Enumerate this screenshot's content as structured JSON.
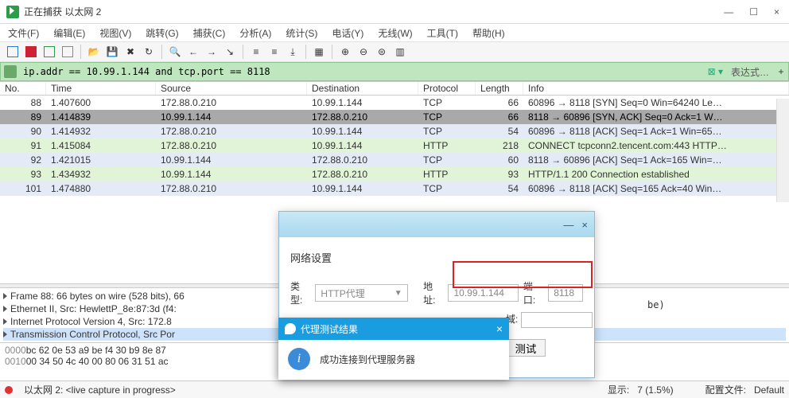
{
  "window": {
    "title": "正在捕获 以太网 2",
    "min": "—",
    "max": "☐",
    "close": "×"
  },
  "menu": [
    "文件(F)",
    "编辑(E)",
    "视图(V)",
    "跳转(G)",
    "捕获(C)",
    "分析(A)",
    "统计(S)",
    "电话(Y)",
    "无线(W)",
    "工具(T)",
    "帮助(H)"
  ],
  "filter": {
    "value": "ip.addr == 10.99.1.144 and tcp.port == 8118",
    "expr_label": "表达式…",
    "plus": "+"
  },
  "columns": {
    "no": "No.",
    "time": "Time",
    "src": "Source",
    "dst": "Destination",
    "proto": "Protocol",
    "len": "Length",
    "info": "Info"
  },
  "packets": [
    {
      "no": "88",
      "time": "1.407600",
      "src": "172.88.0.210",
      "dst": "10.99.1.144",
      "proto": "TCP",
      "len": "66",
      "info": "60896 → 8118 [SYN] Seq=0 Win=64240 Le…",
      "cls": "bg-white"
    },
    {
      "no": "89",
      "time": "1.414839",
      "src": "10.99.1.144",
      "dst": "172.88.0.210",
      "proto": "TCP",
      "len": "66",
      "info": "8118 → 60896 [SYN, ACK] Seq=0 Ack=1 W…",
      "cls": "bg-sel"
    },
    {
      "no": "90",
      "time": "1.414932",
      "src": "172.88.0.210",
      "dst": "10.99.1.144",
      "proto": "TCP",
      "len": "54",
      "info": "60896 → 8118 [ACK] Seq=1 Ack=1 Win=65…",
      "cls": "bg-blue"
    },
    {
      "no": "91",
      "time": "1.415084",
      "src": "172.88.0.210",
      "dst": "10.99.1.144",
      "proto": "HTTP",
      "len": "218",
      "info": "CONNECT tcpconn2.tencent.com:443 HTTP…",
      "cls": "bg-green"
    },
    {
      "no": "92",
      "time": "1.421015",
      "src": "10.99.1.144",
      "dst": "172.88.0.210",
      "proto": "TCP",
      "len": "60",
      "info": "8118 → 60896 [ACK] Seq=1 Ack=165 Win=…",
      "cls": "bg-blue"
    },
    {
      "no": "93",
      "time": "1.434932",
      "src": "10.99.1.144",
      "dst": "172.88.0.210",
      "proto": "HTTP",
      "len": "93",
      "info": "HTTP/1.1 200 Connection established",
      "cls": "bg-green"
    },
    {
      "no": "101",
      "time": "1.474880",
      "src": "172.88.0.210",
      "dst": "10.99.1.144",
      "proto": "TCP",
      "len": "54",
      "info": "60896 → 8118 [ACK] Seq=165 Ack=40 Win…",
      "cls": "bg-blue"
    }
  ],
  "detail": {
    "l1": "Frame 88: 66 bytes on wire (528 bits), 66",
    "l2": "Ethernet II, Src: HewlettP_8e:87:3d (f4:",
    "l3": "Internet Protocol Version 4, Src: 172.8",
    "l4": "Transmission Control Protocol, Src Por"
  },
  "hex": {
    "a0": "0000",
    "b0": "bc 62 0e 53 a9 be f4 30  b9 8e 87",
    "a1": "0010",
    "b1": "00 34 50 4c 40 00 80 06  31 51 ac"
  },
  "status": {
    "iface": "以太网 2: <live capture in progress>",
    "pkts_lbl": "显示:",
    "pkts_val": "7 (1.5%)",
    "profile_lbl": "配置文件:",
    "profile_val": "Default"
  },
  "dialog": {
    "section": "网络设置",
    "type_lbl": "类型:",
    "type_val": "HTTP代理",
    "addr_lbl": "地址:",
    "addr_val": "10.99.1.144",
    "port_lbl": "端口:",
    "port_val": "8118",
    "domain_lbl": "域:",
    "test_btn": "测试",
    "min": "—",
    "close": "×",
    "be_fragment": "be)"
  },
  "toast": {
    "title": "代理测试结果",
    "msg": "成功连接到代理服务器",
    "close": "×"
  }
}
